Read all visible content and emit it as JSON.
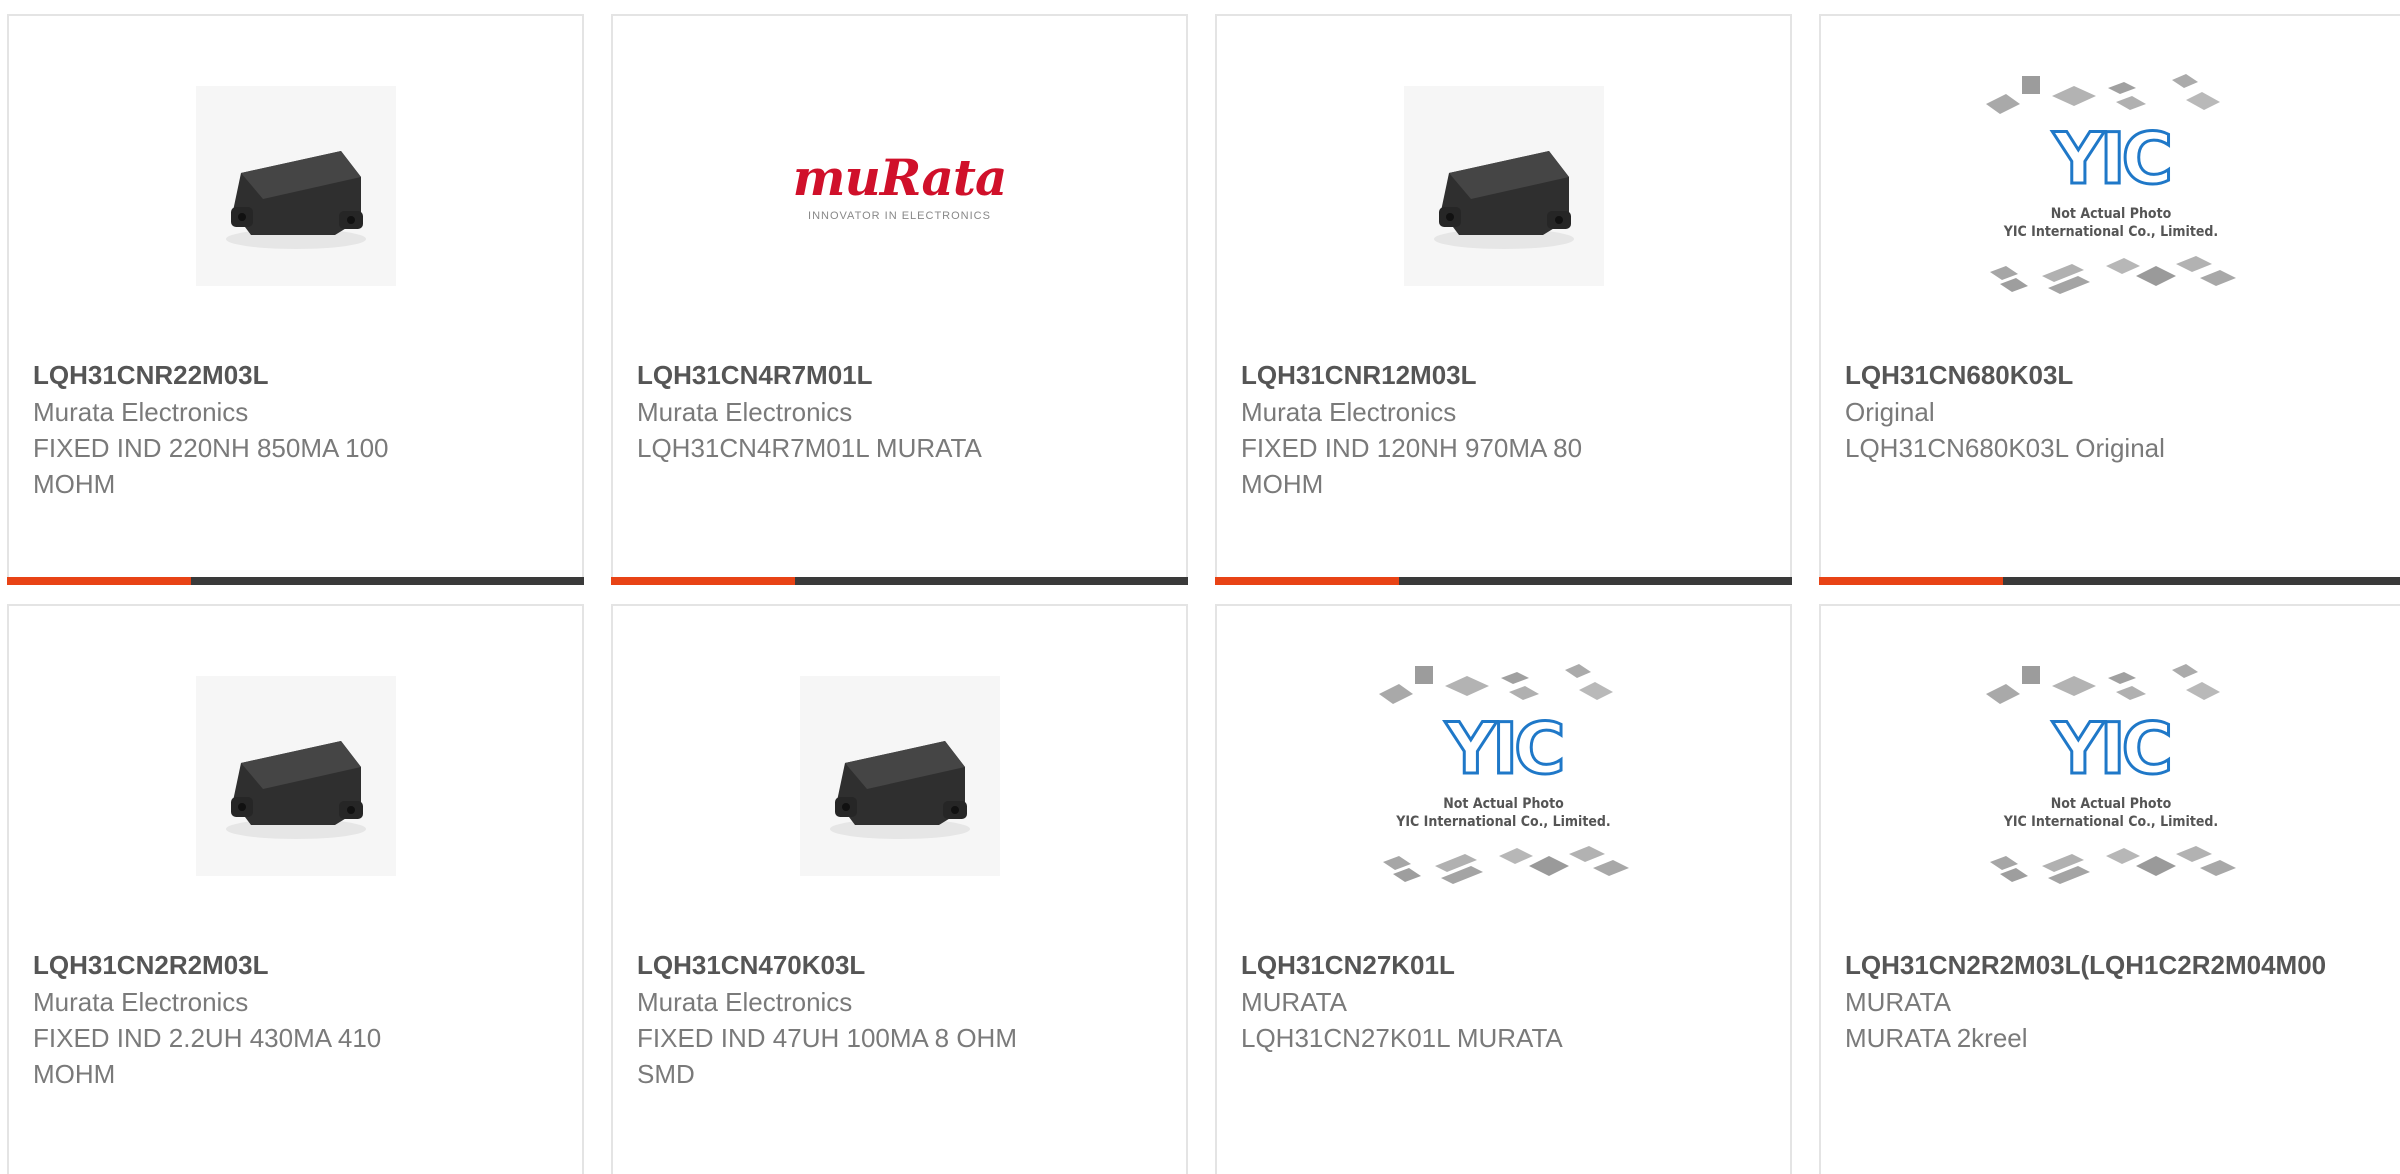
{
  "products": [
    {
      "part_number": "LQH31CNR22M03L",
      "manufacturer": "Murata Electronics",
      "description": "FIXED IND 220NH 850MA 100 MOHM",
      "image": "inductor-photo"
    },
    {
      "part_number": "LQH31CN4R7M01L",
      "manufacturer": "Murata Electronics",
      "description": "LQH31CN4R7M01L MURATA",
      "image": "murata-logo",
      "logo_text": "muRata",
      "logo_tagline": "INNOVATOR IN ELECTRONICS"
    },
    {
      "part_number": "LQH31CNR12M03L",
      "manufacturer": "Murata Electronics",
      "description": "FIXED IND 120NH 970MA 80 MOHM",
      "image": "inductor-photo"
    },
    {
      "part_number": "LQH31CN680K03L",
      "manufacturer": "Original",
      "description": "LQH31CN680K03L Original",
      "image": "yic-placeholder"
    },
    {
      "part_number": "LQH31CN2R2M03L",
      "manufacturer": "Murata Electronics",
      "description": "FIXED IND 2.2UH 430MA 410 MOHM",
      "image": "inductor-photo"
    },
    {
      "part_number": "LQH31CN470K03L",
      "manufacturer": "Murata Electronics",
      "description": "FIXED IND 47UH 100MA 8 OHM SMD",
      "image": "inductor-photo"
    },
    {
      "part_number": "LQH31CN27K01L",
      "manufacturer": "MURATA",
      "description": "LQH31CN27K01L MURATA",
      "image": "yic-placeholder"
    },
    {
      "part_number": "LQH31CN2R2M03L(LQH1C2R2M04M00",
      "manufacturer": "MURATA",
      "description": "MURATA 2kreel",
      "image": "yic-placeholder"
    }
  ],
  "yic_placeholder": {
    "logo_text": "YIC",
    "note_line1": "Not Actual Photo",
    "note_line2": "YIC International Co., Limited."
  },
  "colors": {
    "accent_bar": "#e84315",
    "bar_dark": "#3a3a3a",
    "murata_red": "#d0102a",
    "yic_blue": "#1f78c8"
  }
}
